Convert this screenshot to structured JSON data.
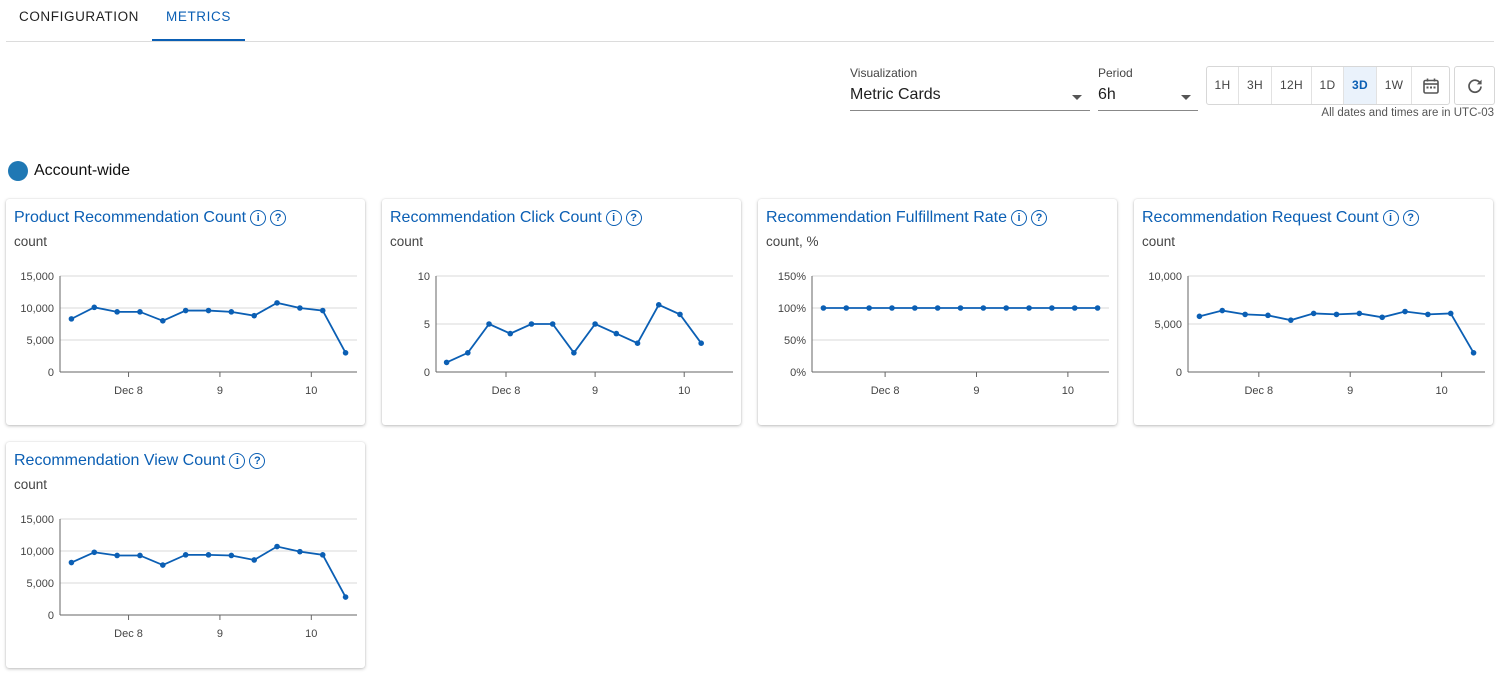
{
  "tabs": [
    {
      "label": "CONFIGURATION",
      "active": false
    },
    {
      "label": "METRICS",
      "active": true
    }
  ],
  "controls": {
    "visualization": {
      "label": "Visualization",
      "value": "Metric Cards"
    },
    "period": {
      "label": "Period",
      "value": "6h"
    },
    "ranges": [
      "1H",
      "3H",
      "12H",
      "1D",
      "3D",
      "1W"
    ],
    "active_range": "3D",
    "calendar_icon": "calendar-icon",
    "refresh_icon": "refresh-icon",
    "timezone_note": "All dates and times are in UTC-03"
  },
  "group": {
    "label": "Account-wide",
    "color": "#1f78b4"
  },
  "colors": {
    "accent": "#0b5fb4",
    "series": "#0b5fb4",
    "grid": "#d9d9d9"
  },
  "chart_data": [
    {
      "type": "line",
      "title": "Product Recommendation Count",
      "unit": "count",
      "yticks": [
        "0",
        "5,000",
        "10,000",
        "15,000"
      ],
      "ylim": [
        0,
        15000
      ],
      "xticks": [
        "Dec 8",
        "9",
        "10"
      ],
      "xtick_positions": [
        3,
        7,
        11
      ],
      "x_count": 13,
      "values": [
        8300,
        10100,
        9400,
        9400,
        8000,
        9600,
        9600,
        9400,
        8800,
        10800,
        10000,
        9600,
        3000
      ]
    },
    {
      "type": "line",
      "title": "Recommendation Click Count",
      "unit": "count",
      "yticks": [
        "0",
        "5",
        "10"
      ],
      "ylim": [
        0,
        10
      ],
      "xticks": [
        "Dec 8",
        "9",
        "10"
      ],
      "xtick_positions": [
        3.3,
        7.5,
        11.7
      ],
      "x_count": 14,
      "values": [
        1,
        2,
        5,
        4,
        5,
        5,
        2,
        5,
        4,
        3,
        7,
        6,
        3
      ]
    },
    {
      "type": "line",
      "title": "Recommendation Fulfillment Rate",
      "unit": "count, %",
      "yticks": [
        "0%",
        "50%",
        "100%",
        "150%"
      ],
      "ylim": [
        0,
        150
      ],
      "xticks": [
        "Dec 8",
        "9",
        "10"
      ],
      "xtick_positions": [
        3.2,
        7.2,
        11.2
      ],
      "x_count": 13,
      "values": [
        100,
        100,
        100,
        100,
        100,
        100,
        100,
        100,
        100,
        100,
        100,
        100,
        100
      ]
    },
    {
      "type": "line",
      "title": "Recommendation Request Count",
      "unit": "count",
      "yticks": [
        "0",
        "5,000",
        "10,000"
      ],
      "ylim": [
        0,
        10000
      ],
      "xticks": [
        "Dec 8",
        "9",
        "10"
      ],
      "xtick_positions": [
        3.1,
        7.1,
        11.1
      ],
      "x_count": 13,
      "values": [
        5800,
        6400,
        6000,
        5900,
        5400,
        6100,
        6000,
        6100,
        5700,
        6300,
        6000,
        6100,
        2000
      ]
    },
    {
      "type": "line",
      "title": "Recommendation View Count",
      "unit": "count",
      "yticks": [
        "0",
        "5,000",
        "10,000",
        "15,000"
      ],
      "ylim": [
        0,
        15000
      ],
      "xticks": [
        "Dec 8",
        "9",
        "10"
      ],
      "xtick_positions": [
        3,
        7,
        11
      ],
      "x_count": 13,
      "values": [
        8200,
        9800,
        9300,
        9300,
        7800,
        9400,
        9400,
        9300,
        8600,
        10700,
        9900,
        9400,
        2800
      ]
    }
  ]
}
